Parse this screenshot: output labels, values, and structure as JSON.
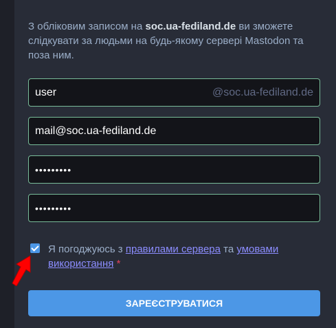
{
  "intro": {
    "text_before": "З обліковим записом на ",
    "server": "soc.ua-fediland.de",
    "text_after": " ви зможете слідкувати за людьми на будь-якому сервері Mastodon та поза ним."
  },
  "form": {
    "username": {
      "value": "user",
      "suffix": "@soc.ua-fediland.de"
    },
    "email": {
      "value": "mail@soc.ua-fediland.de"
    },
    "password": {
      "value": "•••••••••"
    },
    "password_confirm": {
      "value": "•••••••••"
    }
  },
  "agreement": {
    "checked": true,
    "prefix": "Я погоджуюсь з ",
    "server_rules_link": "правилами сервера",
    "middle": " та ",
    "terms_link": "умовами використання",
    "required_mark": "*"
  },
  "submit_label": "ЗАРЕЄСТРУВАТИСЯ",
  "colors": {
    "accent": "#4c97e6",
    "valid_border": "#79bd9a",
    "link": "#8c8dff",
    "required": "#df405a",
    "annotation_arrow": "#ff0000"
  }
}
